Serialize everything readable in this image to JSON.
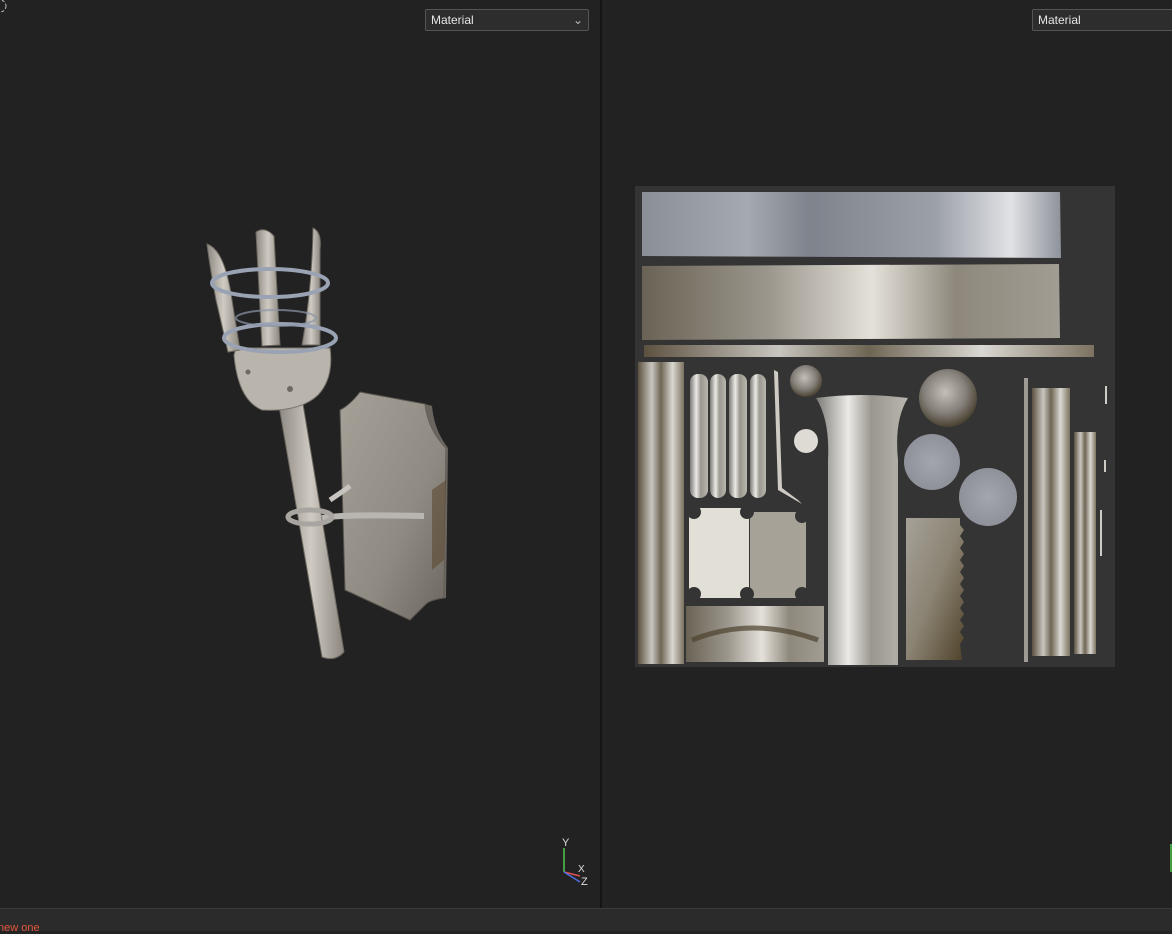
{
  "left_viewport": {
    "dropdown": {
      "selected": "Material"
    },
    "axis_gizmo": {
      "y": "Y",
      "x": "X",
      "z": "Z"
    }
  },
  "right_viewport": {
    "dropdown": {
      "selected": "Material"
    }
  },
  "status_bar": {
    "message": "new one"
  },
  "colors": {
    "background": "#222222",
    "status_text": "#e0563a",
    "axis_y": "#4fc84f",
    "axis_x": "#e05050",
    "axis_z": "#5070e0"
  }
}
